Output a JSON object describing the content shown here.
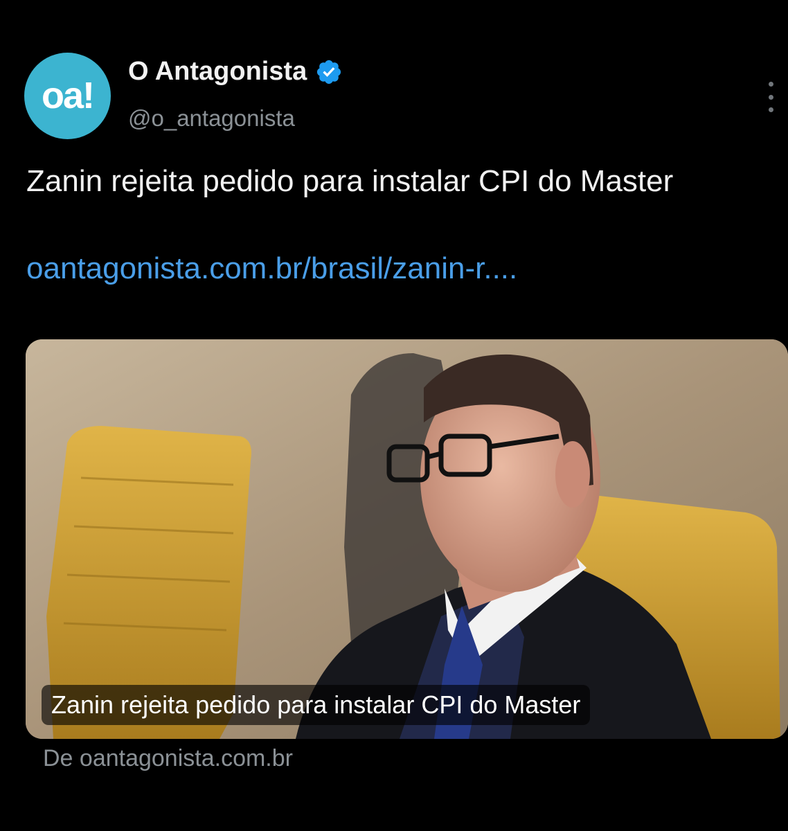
{
  "account": {
    "avatar_text": "oa!",
    "display_name": "O Antagonista",
    "handle": "@o_antagonista",
    "verified_icon": "verified-badge-icon",
    "avatar_color": "#3cb4d0"
  },
  "tweet": {
    "text": "Zanin rejeita pedido para instalar CPI do Master",
    "link": "oantagonista.com.br/brasil/zanin-r...."
  },
  "card": {
    "caption": "Zanin rejeita pedido para instalar CPI do Master",
    "source": "De oantagonista.com.br"
  },
  "colors": {
    "background": "#000000",
    "link": "#4a9ee8",
    "verified": "#1d9bf0",
    "muted": "#8b9196"
  }
}
